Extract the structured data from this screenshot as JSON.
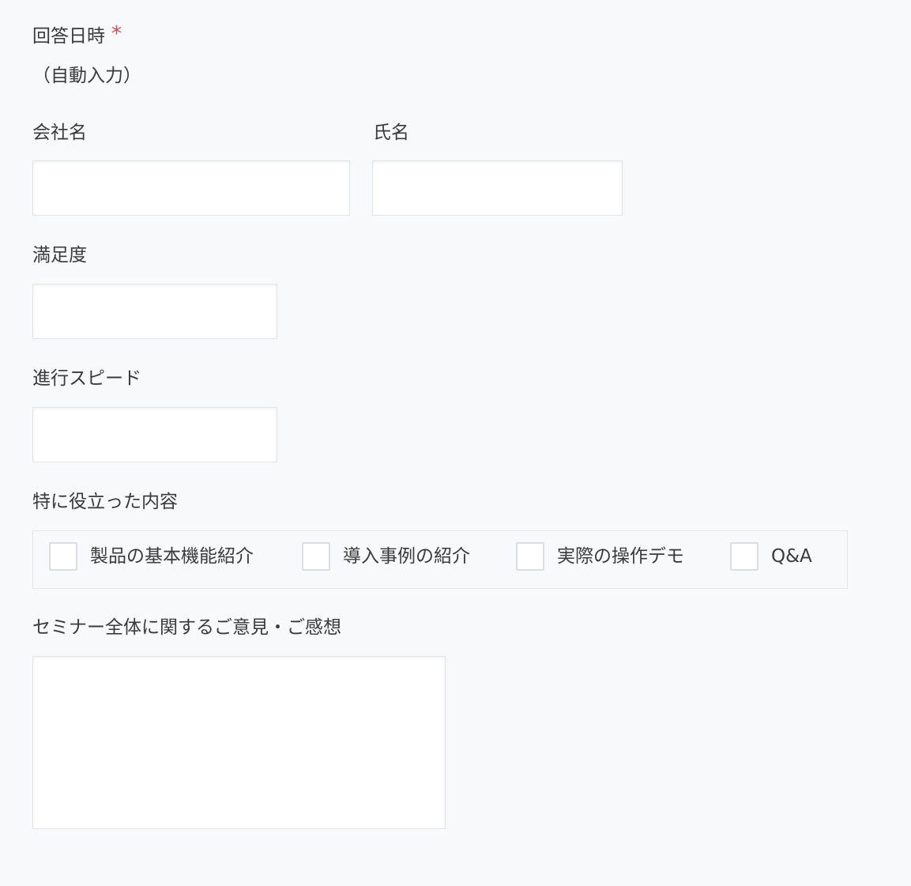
{
  "form": {
    "answer_datetime": {
      "label": "回答日時",
      "required_mark": "*",
      "value": "（自動入力）"
    },
    "company": {
      "label": "会社名",
      "value": ""
    },
    "name": {
      "label": "氏名",
      "value": ""
    },
    "satisfaction": {
      "label": "満足度",
      "value": ""
    },
    "speed": {
      "label": "進行スピード",
      "value": ""
    },
    "useful_content": {
      "label": "特に役立った内容",
      "options": [
        {
          "label": "製品の基本機能紹介",
          "checked": false
        },
        {
          "label": "導入事例の紹介",
          "checked": false
        },
        {
          "label": "実際の操作デモ",
          "checked": false
        },
        {
          "label": "Q&A",
          "checked": false
        }
      ]
    },
    "feedback": {
      "label": "セミナー全体に関するご意見・ご感想",
      "value": ""
    }
  },
  "colors": {
    "background": "#f8f9fa",
    "field_background": "#ffffff",
    "border": "#e2e4e6",
    "text": "#3a3a3a",
    "required": "#e0474c"
  }
}
